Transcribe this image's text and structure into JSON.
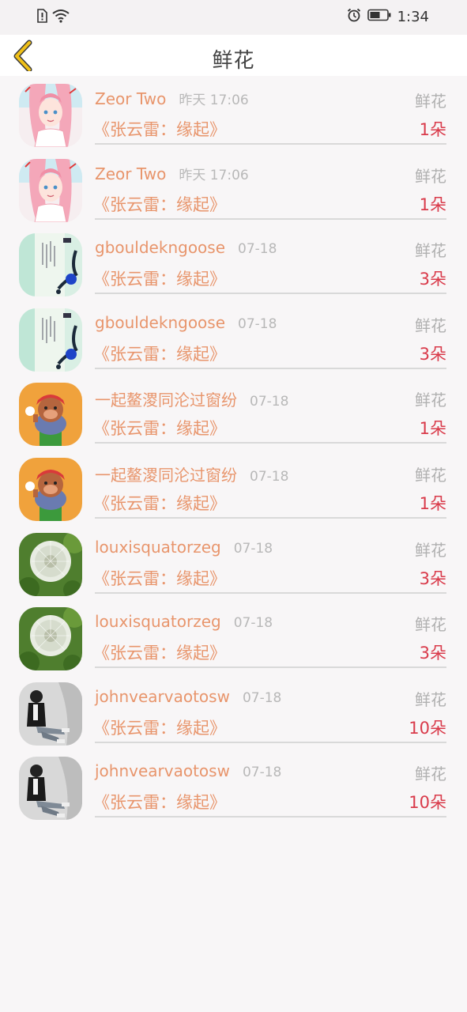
{
  "status_bar": {
    "time": "1:34",
    "icons": [
      "sim-alert-icon",
      "wifi-icon",
      "alarm-icon",
      "battery-icon"
    ]
  },
  "header": {
    "title": "鲜花",
    "back_icon": "chevron-left-icon"
  },
  "colors": {
    "accent": "#e8956c",
    "count": "#d93a4a",
    "back": "#f0c018"
  },
  "records": [
    {
      "user": "Zeor Two",
      "time": "昨天 17:06",
      "type": "鲜花",
      "book": "《张云雷：缘起》",
      "count": "1朵",
      "avatar": "anime-girl-avatar"
    },
    {
      "user": "Zeor Two",
      "time": "昨天 17:06",
      "type": "鲜花",
      "book": "《张云雷：缘起》",
      "count": "1朵",
      "avatar": "anime-girl-avatar"
    },
    {
      "user": "gbouldekngoose",
      "time": "07-18",
      "type": "鲜花",
      "book": "《张云雷：缘起》",
      "count": "3朵",
      "avatar": "ink-painting-avatar"
    },
    {
      "user": "gbouldekngoose",
      "time": "07-18",
      "type": "鲜花",
      "book": "《张云雷：缘起》",
      "count": "3朵",
      "avatar": "ink-painting-avatar"
    },
    {
      "user": "一起鳌溭同沦过窗纷",
      "time": "07-18",
      "type": "鲜花",
      "book": "《张云雷：缘起》",
      "count": "1朵",
      "avatar": "cartoon-bear-avatar"
    },
    {
      "user": "一起鳌溭同沦过窗纷",
      "time": "07-18",
      "type": "鲜花",
      "book": "《张云雷：缘起》",
      "count": "1朵",
      "avatar": "cartoon-bear-avatar"
    },
    {
      "user": "louxisquatorzeg",
      "time": "07-18",
      "type": "鲜花",
      "book": "《张云雷：缘起》",
      "count": "3朵",
      "avatar": "dandelion-avatar"
    },
    {
      "user": "louxisquatorzeg",
      "time": "07-18",
      "type": "鲜花",
      "book": "《张云雷：缘起》",
      "count": "3朵",
      "avatar": "dandelion-avatar"
    },
    {
      "user": "johnvearvaotosw",
      "time": "07-18",
      "type": "鲜花",
      "book": "《张云雷：缘起》",
      "count": "10朵",
      "avatar": "person-photo-avatar"
    },
    {
      "user": "johnvearvaotosw",
      "time": "07-18",
      "type": "鲜花",
      "book": "《张云雷：缘起》",
      "count": "10朵",
      "avatar": "person-photo-avatar"
    }
  ]
}
